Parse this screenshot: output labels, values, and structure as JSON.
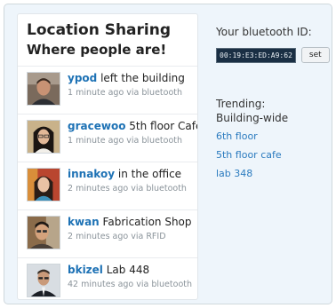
{
  "feed": {
    "title": "Location Sharing",
    "subtitle": "Where people are!",
    "items": [
      {
        "user": "ypod",
        "location": "left the building",
        "meta": "1 minute ago via bluetooth"
      },
      {
        "user": "gracewoo",
        "location": "5th floor Cafe",
        "meta": "1 minute ago via bluetooth"
      },
      {
        "user": "innakoy",
        "location": "in the office",
        "meta": "2 minutes ago via bluetooth"
      },
      {
        "user": "kwan",
        "location": "Fabrication Shop",
        "meta": "2 minutes ago via RFID"
      },
      {
        "user": "bkizel",
        "location": "Lab 448",
        "meta": "42 minutes ago via bluetooth"
      }
    ]
  },
  "sidebar": {
    "bluetooth_label": "Your bluetooth ID:",
    "bluetooth_id": "00:19:E3:ED:A9:62",
    "set_label": "set",
    "trending_title": "Trending:",
    "trending_scope": "Building-wide",
    "trending_links": [
      "6th floor",
      "5th floor cafe",
      "lab 348"
    ]
  },
  "colors": {
    "link": "#1e72b5",
    "side_background": "#eef5fb",
    "id_field": "#1a2f44"
  }
}
